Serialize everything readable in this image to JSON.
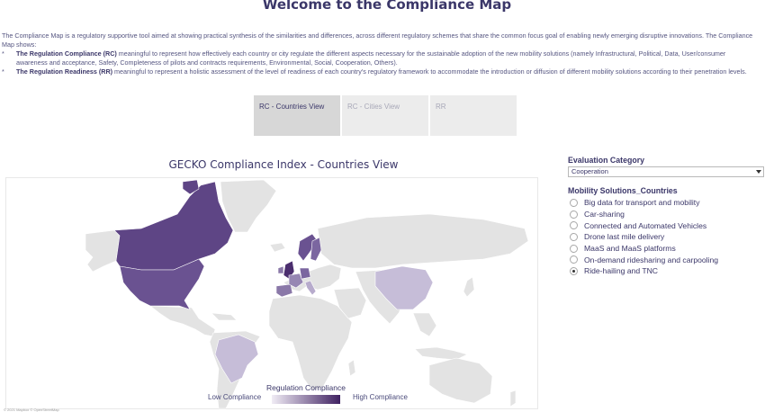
{
  "page": {
    "title": "Welcome to the Compliance Map"
  },
  "intro": {
    "paragraph": "The Compliance Map is a regulatory supportive tool aimed at showing practical synthesis of the similarities and differences, across different regulatory schemes that share the common  focus goal of enabling newly emerging disruptive innovations. The Compliance Map shows:",
    "bullets": [
      {
        "mark": "*",
        "term": "The  Regulation Compliance (RC)",
        "text": " meaningful to represent how effectively each country or city regulate the different aspects necessary for the sustainable adoption of the new mobility solutions (namely Infrastructural, Political, Data, User/consumer awareness and acceptance, Safety, Completeness of pilots and contracts requirements, Environmental, Social, Cooperation, Others)."
      },
      {
        "mark": "*",
        "term": "The Regulation Readiness (RR)",
        "text": " meaningful to represent a holistic assessment of the level of readiness of each country's regulatory framework to accommodate the introduction or diffusion of different mobility solutions according to their penetration levels."
      }
    ]
  },
  "tabs": [
    {
      "label": "RC - Countries View",
      "active": true
    },
    {
      "label": "RC - Cities View",
      "active": false
    },
    {
      "label": "RR",
      "active": false
    }
  ],
  "map": {
    "title": "GECKO Compliance Index - Countries View",
    "legend": {
      "title": "Regulation Compliance",
      "low": "Low Compliance",
      "high": "High Compliance"
    },
    "copyright": "© 2021 Mapbox © OpenStreetMap",
    "colors": {
      "land": "#e3e3e3",
      "border": "#ffffff",
      "low": "#f0ecf5",
      "high": "#3f2161"
    },
    "highlighted_regions": [
      {
        "name": "Canada",
        "level": 0.75
      },
      {
        "name": "United States",
        "level": 0.7
      },
      {
        "name": "Greenland",
        "level": 0.0
      },
      {
        "name": "United Kingdom",
        "level": 0.8
      },
      {
        "name": "Ireland",
        "level": 0.55
      },
      {
        "name": "Spain",
        "level": 0.55
      },
      {
        "name": "France",
        "level": 0.5
      },
      {
        "name": "Germany",
        "level": 0.6
      },
      {
        "name": "Netherlands",
        "level": 0.6
      },
      {
        "name": "Norway",
        "level": 0.7
      },
      {
        "name": "Sweden",
        "level": 0.65
      },
      {
        "name": "Italy",
        "level": 0.35
      },
      {
        "name": "China",
        "level": 0.25
      },
      {
        "name": "Brazil",
        "level": 0.25
      }
    ]
  },
  "evaluation": {
    "heading": "Evaluation Category",
    "selected": "Cooperation"
  },
  "mobility": {
    "heading": "Mobility Solutions_Countries",
    "options": [
      {
        "label": "Big data for transport and mobility",
        "checked": false
      },
      {
        "label": "Car-sharing",
        "checked": false
      },
      {
        "label": "Connected and Automated Vehicles",
        "checked": false
      },
      {
        "label": "Drone last mile delivery",
        "checked": false
      },
      {
        "label": "MaaS and MaaS platforms",
        "checked": false
      },
      {
        "label": "On-demand ridesharing and carpooling",
        "checked": false
      },
      {
        "label": "Ride-hailing and TNC",
        "checked": true
      }
    ]
  }
}
